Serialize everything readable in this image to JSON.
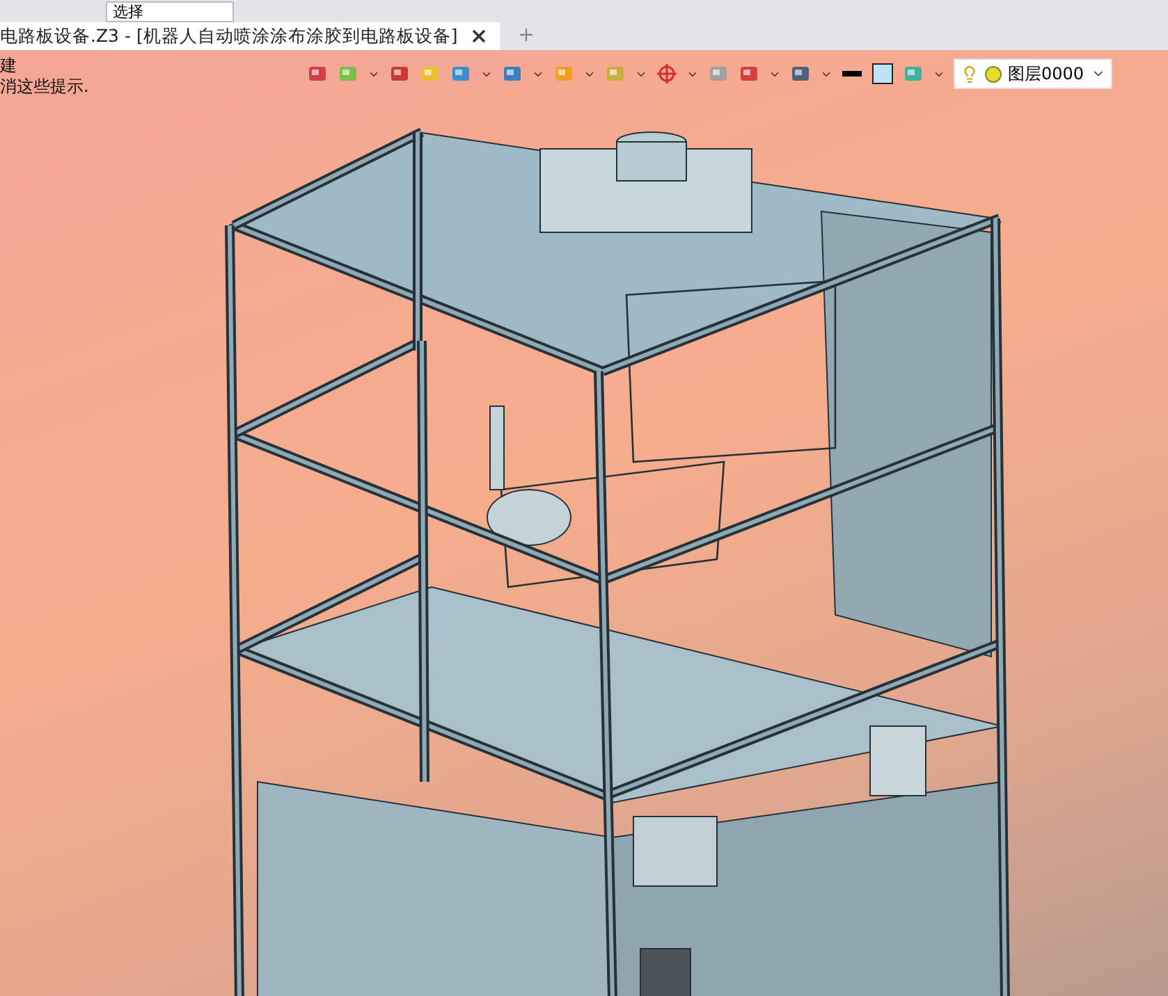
{
  "toolbar": {
    "filter_field": {
      "value": "选择"
    }
  },
  "tabs": [
    {
      "label": "电路板设备.Z3 - [机器人自动喷涂涂布涂胶到电路板设备]",
      "selected": true
    }
  ],
  "hints": [
    "建",
    "消这些提示."
  ],
  "layer_dropdown": {
    "value": "图层0000"
  }
}
